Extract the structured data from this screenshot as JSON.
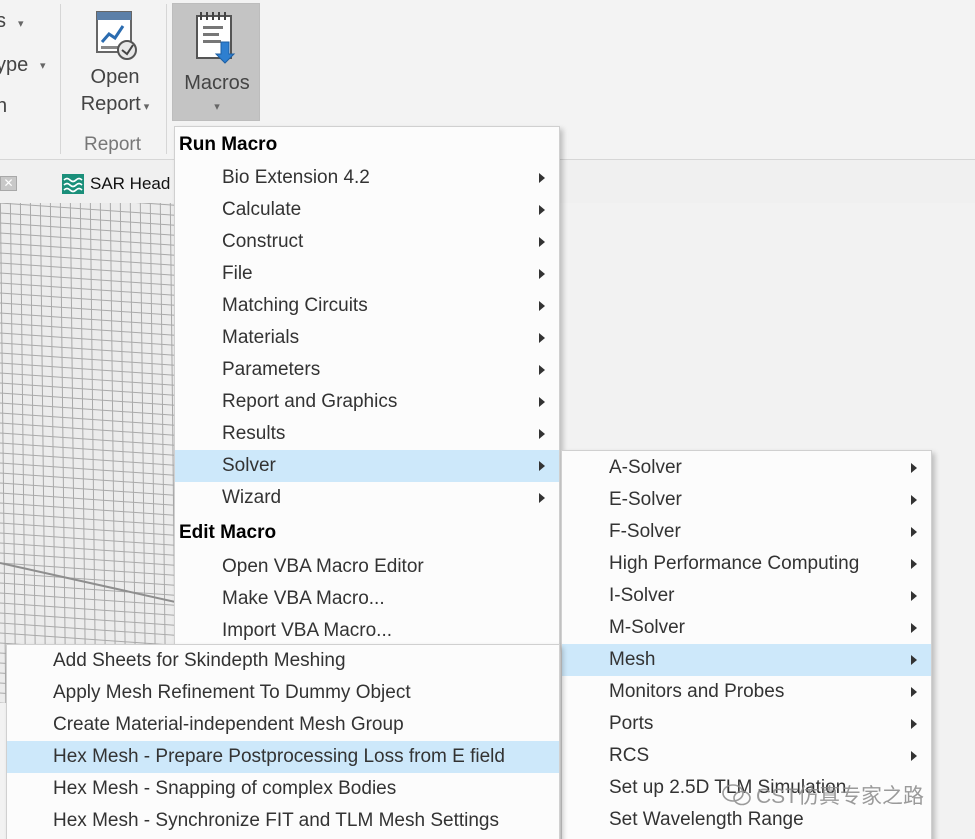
{
  "ribbon": {
    "left_fragments": [
      "s",
      "ype",
      "n"
    ],
    "open_report": {
      "line1": "Open",
      "line2": "Report"
    },
    "report_group": "Report",
    "macros_label": "Macros"
  },
  "tabs": {
    "sar_head": "SAR Head"
  },
  "main_menu": {
    "run_header": "Run Macro",
    "run_items": [
      {
        "label": "Bio Extension 4.2"
      },
      {
        "label": "Calculate"
      },
      {
        "label": "Construct"
      },
      {
        "label": "File"
      },
      {
        "label": "Matching Circuits"
      },
      {
        "label": "Materials"
      },
      {
        "label": "Parameters"
      },
      {
        "label": "Report and Graphics"
      },
      {
        "label": "Results"
      },
      {
        "label": "Solver"
      },
      {
        "label": "Wizard"
      }
    ],
    "edit_header": "Edit Macro",
    "edit_items": [
      {
        "label": "Open VBA Macro Editor"
      },
      {
        "label": "Make VBA Macro..."
      },
      {
        "label": "Import VBA Macro..."
      }
    ]
  },
  "solver_menu": {
    "items": [
      {
        "label": "A-Solver"
      },
      {
        "label": "E-Solver"
      },
      {
        "label": "F-Solver"
      },
      {
        "label": "High Performance Computing"
      },
      {
        "label": "I-Solver"
      },
      {
        "label": "M-Solver"
      },
      {
        "label": "Mesh"
      },
      {
        "label": "Monitors and Probes"
      },
      {
        "label": "Ports"
      },
      {
        "label": "RCS"
      },
      {
        "label": "Set up 2.5D TLM Simulation"
      },
      {
        "label": "Set Wavelength Range"
      }
    ]
  },
  "mesh_menu": {
    "items": [
      {
        "label": "Add Sheets for Skindepth Meshing"
      },
      {
        "label": "Apply Mesh Refinement To Dummy Object"
      },
      {
        "label": "Create Material-independent Mesh Group"
      },
      {
        "label": "Hex Mesh - Prepare Postprocessing Loss from E field"
      },
      {
        "label": "Hex Mesh - Snapping of complex Bodies"
      },
      {
        "label": "Hex Mesh - Synchronize FIT and TLM Mesh Settings"
      }
    ]
  },
  "watermark": "CST仿真专家之路",
  "colors": {
    "highlight": "#cde8fa",
    "macros_pressed": "#c4c4c4",
    "sar_icon": "#1a8f7a"
  }
}
